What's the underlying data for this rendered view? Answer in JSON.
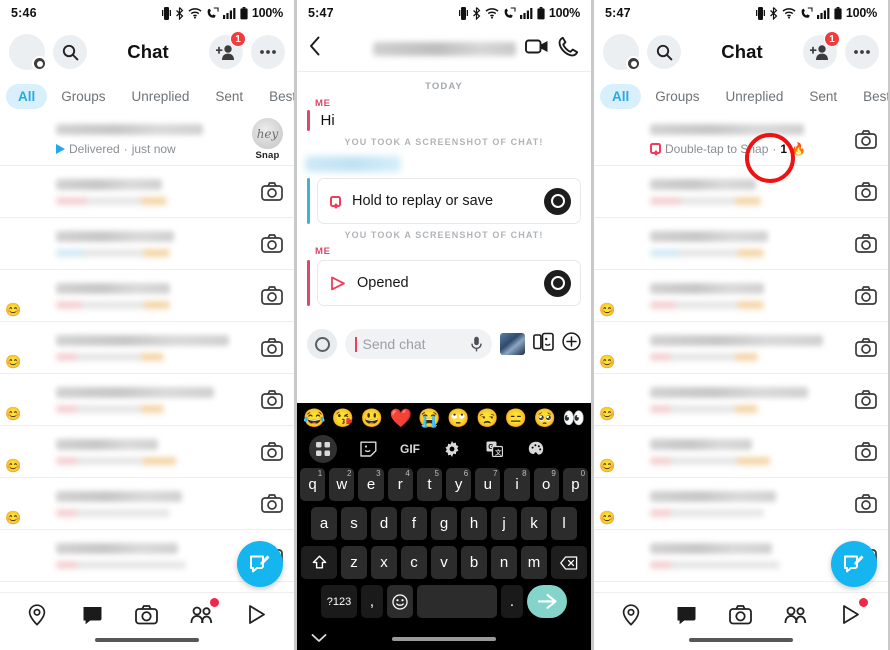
{
  "panels": [
    {
      "id": "chat-list-before",
      "statusbar": {
        "time": "5:46",
        "battery": "100%"
      },
      "header": {
        "title": "Chat",
        "add_friend_badge": "1"
      },
      "tabs": [
        {
          "label": "All",
          "active": true
        },
        {
          "label": "Groups",
          "active": false
        },
        {
          "label": "Unreplied",
          "active": false
        },
        {
          "label": "Sent",
          "active": false
        },
        {
          "label": "Best Friend",
          "active": false
        }
      ],
      "rows": [
        {
          "status_text": "Delivered",
          "status_sep": "·",
          "time_text": "just now",
          "status_icon": "sent-arrow-icon",
          "right": "snap-preview",
          "snap_preview_text": "hey",
          "snap_caption": "Snap",
          "blurred": true
        },
        {
          "blurred_sub": true,
          "right": "camera-icon"
        },
        {
          "blurred_sub": true,
          "right": "camera-icon"
        },
        {
          "blurred_sub": true,
          "right": "camera-icon"
        },
        {
          "blurred_sub": true,
          "right": "camera-icon"
        },
        {
          "blurred_sub": true,
          "right": "camera-icon"
        },
        {
          "blurred_sub": true,
          "right": "camera-icon"
        },
        {
          "blurred_sub": true,
          "right": "camera-icon"
        },
        {
          "blurred_sub": true,
          "right": "camera-icon"
        }
      ],
      "fab": "compose-chat-icon",
      "nav": [
        {
          "name": "map",
          "active": false,
          "dot": false
        },
        {
          "name": "chat",
          "active": true,
          "dot": false
        },
        {
          "name": "camera",
          "active": false,
          "dot": false
        },
        {
          "name": "friends",
          "active": false,
          "dot": true
        },
        {
          "name": "stories",
          "active": false,
          "dot": false
        }
      ]
    },
    {
      "id": "conversation",
      "statusbar": {
        "time": "5:47",
        "battery": "100%"
      },
      "conv": {
        "day_separator": "TODAY",
        "me_label": "ME",
        "first_message": "Hi",
        "screenshot_note_1": "YOU TOOK A SCREENSHOT OF CHAT!",
        "screenshot_note_2": "YOU TOOK A SCREENSHOT OF CHAT!",
        "card_1_label": "Hold to replay or save",
        "card_2_label": "Opened"
      },
      "composer": {
        "placeholder": "Send chat"
      },
      "emoji_strip": [
        "😂",
        "😘",
        "😃",
        "❤️",
        "😭",
        "🙄",
        "😒",
        "😑",
        "🥺",
        "👀"
      ],
      "kb_tools": [
        "grid-icon",
        "sticker-icon",
        "GIF",
        "settings-icon",
        "translate-icon",
        "theme-icon"
      ],
      "keyboard": {
        "row1": [
          {
            "k": "q",
            "n": "1"
          },
          {
            "k": "w",
            "n": "2"
          },
          {
            "k": "e",
            "n": "3"
          },
          {
            "k": "r",
            "n": "4"
          },
          {
            "k": "t",
            "n": "5"
          },
          {
            "k": "y",
            "n": "6"
          },
          {
            "k": "u",
            "n": "7"
          },
          {
            "k": "i",
            "n": "8"
          },
          {
            "k": "o",
            "n": "9"
          },
          {
            "k": "p",
            "n": "0"
          }
        ],
        "row2": [
          "a",
          "s",
          "d",
          "f",
          "g",
          "h",
          "j",
          "k",
          "l"
        ],
        "row3": [
          "z",
          "x",
          "c",
          "v",
          "b",
          "n",
          "m"
        ],
        "shift_label": "shift-icon",
        "backspace_label": "backspace-icon",
        "num_key": "?123",
        "comma": ",",
        "emoji_key": "emoji-icon",
        "period": ".",
        "send_label": "send-icon"
      }
    },
    {
      "id": "chat-list-after",
      "statusbar": {
        "time": "5:47",
        "battery": "100%"
      },
      "header": {
        "title": "Chat",
        "add_friend_badge": "1"
      },
      "tabs": [
        {
          "label": "All",
          "active": true
        },
        {
          "label": "Groups",
          "active": false
        },
        {
          "label": "Unreplied",
          "active": false
        },
        {
          "label": "Sent",
          "active": false
        },
        {
          "label": "Best Friend",
          "active": false
        }
      ],
      "first_row": {
        "status_text": "Double-tap to Snap",
        "status_sep": "·",
        "streak_count": "1",
        "streak_emoji": "🔥",
        "status_icon": "chat-received-icon"
      },
      "annotation": {
        "shape": "circle",
        "color": "#ee1212"
      },
      "fab": "compose-chat-icon",
      "nav": [
        {
          "name": "map",
          "active": false,
          "dot": false
        },
        {
          "name": "chat",
          "active": true,
          "dot": false
        },
        {
          "name": "camera",
          "active": false,
          "dot": false
        },
        {
          "name": "friends",
          "active": false,
          "dot": false
        },
        {
          "name": "stories",
          "active": false,
          "dot": true
        }
      ]
    }
  ]
}
